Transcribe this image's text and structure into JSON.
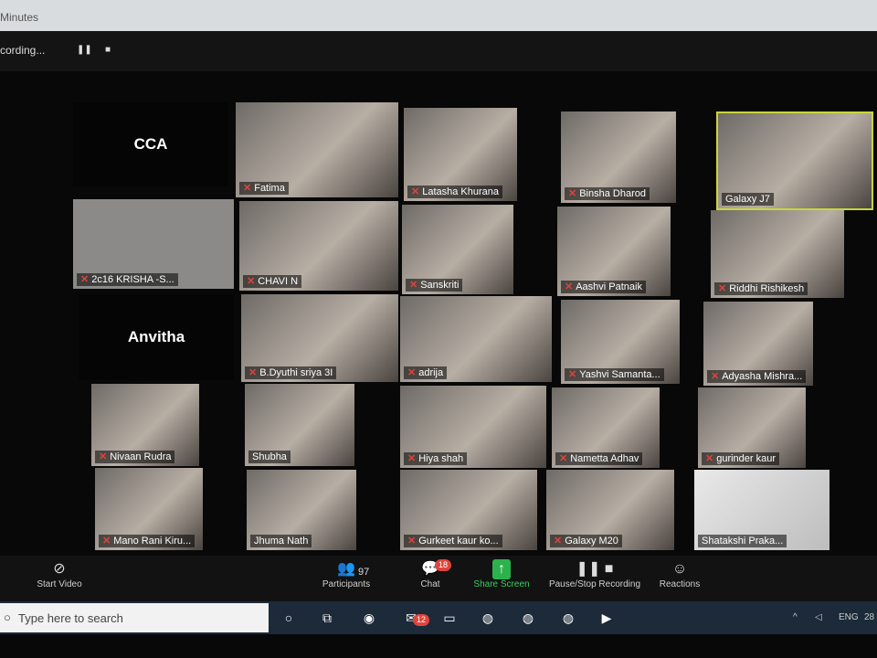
{
  "window": {
    "title": "Minutes"
  },
  "recording": {
    "status": "cording...",
    "pause_icon": "pause-icon",
    "stop_icon": "stop-icon"
  },
  "tiles": [
    {
      "name": "CCA"
    },
    {
      "name": "Fatima"
    },
    {
      "name": "Latasha Khurana"
    },
    {
      "name": "Binsha Dharod"
    },
    {
      "name": "Galaxy J7"
    },
    {
      "name": "2c16 KRISHA -S..."
    },
    {
      "name": "CHAVI N"
    },
    {
      "name": "Sanskriti"
    },
    {
      "name": "Aashvi Patnaik"
    },
    {
      "name": "Riddhi Rishikesh"
    },
    {
      "name": "Anvitha"
    },
    {
      "name": "B.Dyuthi sriya 3I"
    },
    {
      "name": "adrija"
    },
    {
      "name": "Yashvi Samanta..."
    },
    {
      "name": "Adyasha Mishra..."
    },
    {
      "name": "Nivaan Rudra"
    },
    {
      "name": "Shubha"
    },
    {
      "name": "Hiya shah"
    },
    {
      "name": "Nametta Adhav"
    },
    {
      "name": "gurinder kaur"
    },
    {
      "name": "Mano Rani Kiru..."
    },
    {
      "name": "Jhuma Nath"
    },
    {
      "name": "Gurkeet kaur ko..."
    },
    {
      "name": "Galaxy M20"
    },
    {
      "name": "Shatakshi Praka..."
    }
  ],
  "toolbar": {
    "start_video": "Start Video",
    "participants": "Participants",
    "participants_count": "97",
    "chat": "Chat",
    "chat_badge": "18",
    "share_screen": "Share Screen",
    "pause_stop": "Pause/Stop Recording",
    "reactions": "Reactions"
  },
  "taskbar": {
    "search_placeholder": "Type here to search",
    "mail_badge": "12",
    "language": "ENG",
    "clock": "28"
  },
  "colors": {
    "active_speaker": "#c9d63a",
    "share_green": "#2bb24c",
    "mute_red": "#e0443c"
  }
}
